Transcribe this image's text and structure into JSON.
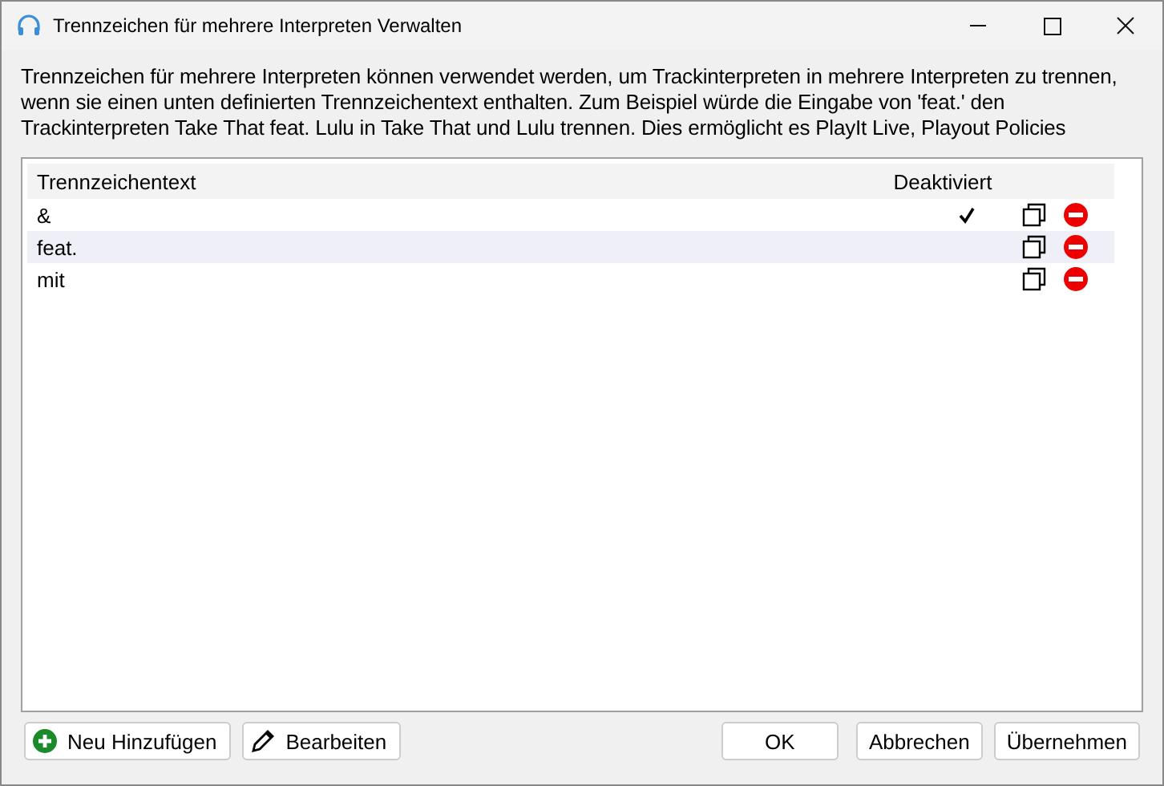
{
  "window": {
    "title": "Trennzeichen für mehrere Interpreten Verwalten"
  },
  "description": "Trennzeichen für mehrere Interpreten können verwendet werden, um Trackinterpreten in mehrere Interpreten zu trennen, wenn sie einen unten definierten Trennzeichentext enthalten. Zum Beispiel würde die Eingabe von 'feat.' den Trackinterpreten Take That feat. Lulu in Take That und Lulu trennen. Dies ermöglicht es PlayIt Live, Playout Policies",
  "table": {
    "columns": [
      "Trennzeichentext",
      "Deaktiviert"
    ],
    "rows": [
      {
        "text": "&",
        "deactivated": true,
        "selected": false
      },
      {
        "text": "feat.",
        "deactivated": false,
        "selected": true
      },
      {
        "text": "mit",
        "deactivated": false,
        "selected": false
      }
    ]
  },
  "buttons_left": [
    {
      "label": "Neu Hinzufügen",
      "kind": "add"
    },
    {
      "label": "Bearbeiten",
      "kind": "edit"
    }
  ],
  "buttons_right": [
    {
      "label": "OK",
      "kind": "plain"
    },
    {
      "label": "Abbrechen",
      "kind": "plain"
    },
    {
      "label": "Übernehmen",
      "kind": "plain"
    }
  ]
}
